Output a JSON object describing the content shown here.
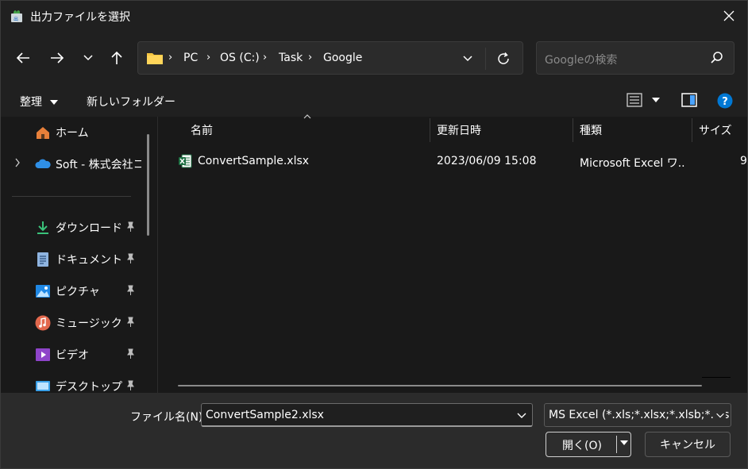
{
  "window": {
    "title": "出力ファイルを選択"
  },
  "nav": {
    "breadcrumbs": [
      "PC",
      "OS (C:)",
      "Task",
      "Google"
    ],
    "search_placeholder": "Googleの検索"
  },
  "commandbar": {
    "organize_label": "整理",
    "new_folder_label": "新しいフォルダー"
  },
  "sidebar": {
    "items": [
      {
        "label": "ホーム",
        "icon": "home-icon",
        "pinned": false
      },
      {
        "label": "Soft - 株式会社コ",
        "icon": "cloud-icon",
        "pinned": false
      },
      {
        "label": "ダウンロード",
        "icon": "download-icon",
        "pinned": true
      },
      {
        "label": "ドキュメント",
        "icon": "document-icon",
        "pinned": true
      },
      {
        "label": "ピクチャ",
        "icon": "pictures-icon",
        "pinned": true
      },
      {
        "label": "ミュージック",
        "icon": "music-icon",
        "pinned": true
      },
      {
        "label": "ビデオ",
        "icon": "video-icon",
        "pinned": true
      },
      {
        "label": "デスクトップ",
        "icon": "desktop-icon",
        "pinned": true
      }
    ]
  },
  "filelist": {
    "columns": [
      "名前",
      "更新日時",
      "種類",
      "サイズ"
    ],
    "rows": [
      {
        "name": "ConvertSample.xlsx",
        "modified": "2023/06/09 15:08",
        "type": "Microsoft Excel ワ...",
        "size": "9"
      }
    ]
  },
  "bottom": {
    "filename_label": "ファイル名(N):",
    "filename_value": "ConvertSample2.xlsx",
    "filetype_value": "MS Excel (*.xls;*.xlsx;*.xlsb;*.xls",
    "open_label": "開く(O)",
    "cancel_label": "キャンセル"
  },
  "colors": {
    "window_bg": "#202020",
    "pane_bg": "#191919",
    "accent_blue": "#0078d4",
    "excel_green": "#1d6f42",
    "folder_yellow": "#f4c542"
  }
}
